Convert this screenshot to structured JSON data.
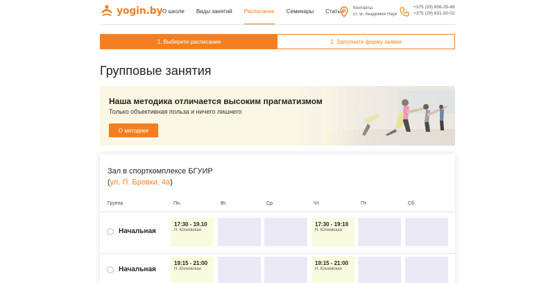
{
  "header": {
    "logo_text": "yogin.by",
    "nav": [
      "О школе",
      "Виды занятий",
      "Расписание",
      "Семинары",
      "Статьи"
    ],
    "active_nav_index": 2,
    "contacts_title": "Контакты",
    "contacts_address": "ст. м. Академия Наук",
    "phones": [
      "+375 (29) 608-29-48",
      "+375 (29) 631-50-02"
    ]
  },
  "steps": {
    "step1": "1. Выберите расписание",
    "step2": "2. Заполните форму заявки"
  },
  "page_title": "Групповые занятия",
  "banner": {
    "title": "Наша методика отличается высоким прагматизмом",
    "subtitle": "Только объективная польза и ничего лишнего",
    "button": "О методике"
  },
  "schedule": {
    "venue": "Зал в спорткомплексе БГУИР",
    "address_open": "(",
    "address": "ул. П. Бровки, 4а",
    "address_close": ")",
    "headers": [
      "Группа",
      "Пн.",
      "Вт.",
      "Ср.",
      "Чт.",
      "Пт.",
      "Сб."
    ],
    "rows": [
      {
        "group": "Начальная",
        "cells": [
          {
            "time": "17:30 - 19.10",
            "coach": "Н. Юхновская"
          },
          {
            "time": "",
            "coach": ""
          },
          {
            "time": "",
            "coach": ""
          },
          {
            "time": "17:30 - 19:10",
            "coach": "Н. Юхновская"
          },
          {
            "time": "",
            "coach": ""
          },
          {
            "time": "",
            "coach": ""
          }
        ]
      },
      {
        "group": "Начальная",
        "cells": [
          {
            "time": "19:15 - 21:00",
            "coach": "Н. Юхновская"
          },
          {
            "time": "",
            "coach": ""
          },
          {
            "time": "",
            "coach": ""
          },
          {
            "time": "19:15 - 21:00",
            "coach": "Н. Юхновская"
          },
          {
            "time": "",
            "coach": ""
          },
          {
            "time": "",
            "coach": ""
          }
        ]
      }
    ]
  },
  "colors": {
    "accent": "#f47f20",
    "filled_cell": "#f8fbdd",
    "empty_cell": "#ece9f7",
    "banner_bg": "#fbf7e3"
  }
}
